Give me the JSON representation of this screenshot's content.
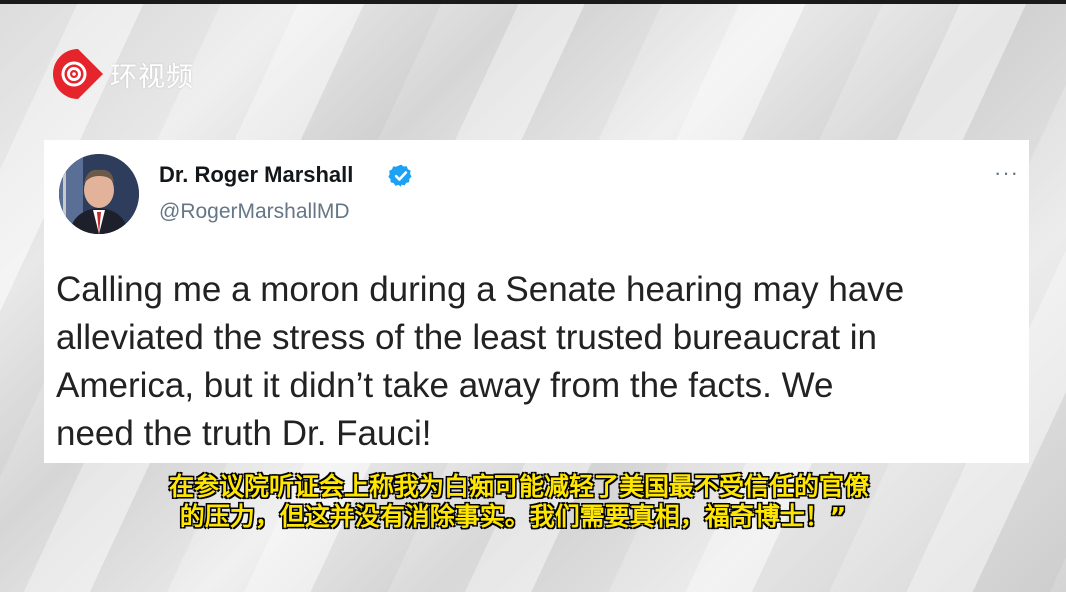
{
  "watermark": {
    "brand_text": "环视频",
    "logo_icon": "play-circle-logo-icon",
    "brand_color": "#e5242b"
  },
  "tweet": {
    "author_name": "Dr. Roger Marshall",
    "handle": "@RogerMarshallMD",
    "verified_icon": "verified-badge-icon",
    "verified_color": "#1da1f2",
    "more_label": "···",
    "text": "Calling me a moron during a Senate hearing may have\nalleviated the stress of the least trusted bureaucrat in\nAmerica, but it didn’t take away from the facts. We\nneed the truth Dr. Fauci!"
  },
  "subtitle": {
    "line1": "在参议院听证会上称我为白痴可能减轻了美国最不受信任的官僚",
    "line2": "的压力，但这并没有消除事实。我们需要真相，福奇博士！”",
    "color": "#ffe600"
  }
}
